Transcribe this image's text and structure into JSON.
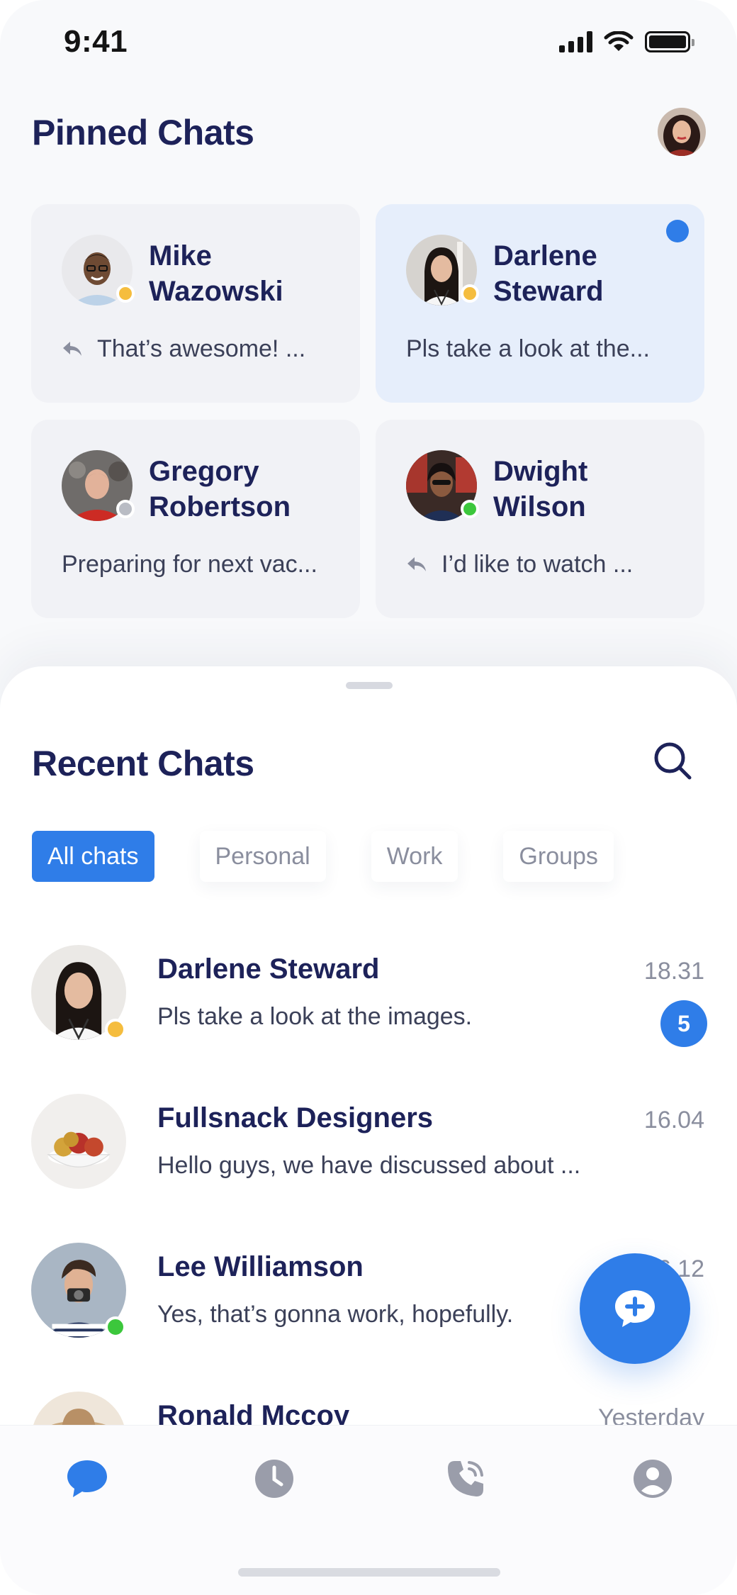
{
  "status_bar": {
    "time": "9:41"
  },
  "pinned": {
    "title": "Pinned Chats",
    "cards": [
      {
        "name": "Mike\nWazowski",
        "preview": "That’s awesome! ...",
        "is_reply": true,
        "presence": "away",
        "unread": false
      },
      {
        "name": "Darlene\nSteward",
        "preview": "Pls take a look at the...",
        "is_reply": false,
        "presence": "away",
        "unread": true
      },
      {
        "name": "Gregory\nRobertson",
        "preview": "Preparing for next vac...",
        "is_reply": false,
        "presence": "offline",
        "unread": false
      },
      {
        "name": "Dwight\nWilson",
        "preview": "I’d like to watch ...",
        "is_reply": true,
        "presence": "online",
        "unread": false
      }
    ]
  },
  "recent": {
    "title": "Recent Chats",
    "filters": [
      {
        "label": "All chats",
        "selected": true
      },
      {
        "label": "Personal",
        "selected": false
      },
      {
        "label": "Work",
        "selected": false
      },
      {
        "label": "Groups",
        "selected": false
      }
    ],
    "chats": [
      {
        "name": "Darlene Steward",
        "message": "Pls take a look at the images.",
        "time": "18.31",
        "unread_count": "5",
        "presence": "away"
      },
      {
        "name": "Fullsnack Designers",
        "message": "Hello guys, we have discussed about ...",
        "time": "16.04",
        "unread_count": null,
        "presence": null
      },
      {
        "name": "Lee Williamson",
        "message": "Yes, that’s gonna work, hopefully.",
        "time": "06.12",
        "unread_count": null,
        "presence": "online"
      },
      {
        "name": "Ronald Mccoy",
        "message": "",
        "time": "Yesterday",
        "unread_count": null,
        "presence": null
      }
    ]
  },
  "tabs": [
    {
      "icon": "chat-icon",
      "active": true
    },
    {
      "icon": "clock-icon",
      "active": false
    },
    {
      "icon": "phone-icon",
      "active": false
    },
    {
      "icon": "profile-icon",
      "active": false
    }
  ],
  "colors": {
    "accent": "#2f7de8",
    "title": "#1d2259",
    "muted": "#8a8e9e",
    "away": "#f5bd3e",
    "online": "#3cc73c",
    "offline": "#b9bcc4"
  }
}
